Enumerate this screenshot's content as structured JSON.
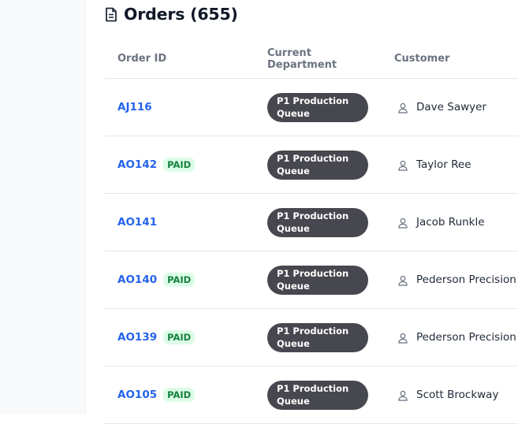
{
  "page": {
    "title": "Orders (655)",
    "title_icon": "document-icon"
  },
  "table": {
    "headers": {
      "order_id": "Order ID",
      "department": "Current Department",
      "customer": "Customer"
    },
    "rows": [
      {
        "order_id": "AJ116",
        "paid": "",
        "dept_line1": "P1 Production",
        "dept_line2": "Queue",
        "customer": "Dave Sawyer"
      },
      {
        "order_id": "AO142",
        "paid": "PAID",
        "dept_line1": "P1 Production",
        "dept_line2": "Queue",
        "customer": "Taylor Ree"
      },
      {
        "order_id": "AO141",
        "paid": "",
        "dept_line1": "P1 Production",
        "dept_line2": "Queue",
        "customer": "Jacob Runkle"
      },
      {
        "order_id": "AO140",
        "paid": "PAID",
        "dept_line1": "P1 Production",
        "dept_line2": "Queue",
        "customer": "Pederson Precision"
      },
      {
        "order_id": "AO139",
        "paid": "PAID",
        "dept_line1": "P1 Production",
        "dept_line2": "Queue",
        "customer": "Pederson Precision"
      },
      {
        "order_id": "AO105",
        "paid": "PAID",
        "dept_line1": "P1 Production",
        "dept_line2": "Queue",
        "customer": "Scott Brockway"
      }
    ]
  },
  "colors": {
    "link": "#2563eb",
    "paid_text": "#15803d",
    "paid_bg": "#dcfce7",
    "dept_pill_bg": "#47474f"
  }
}
